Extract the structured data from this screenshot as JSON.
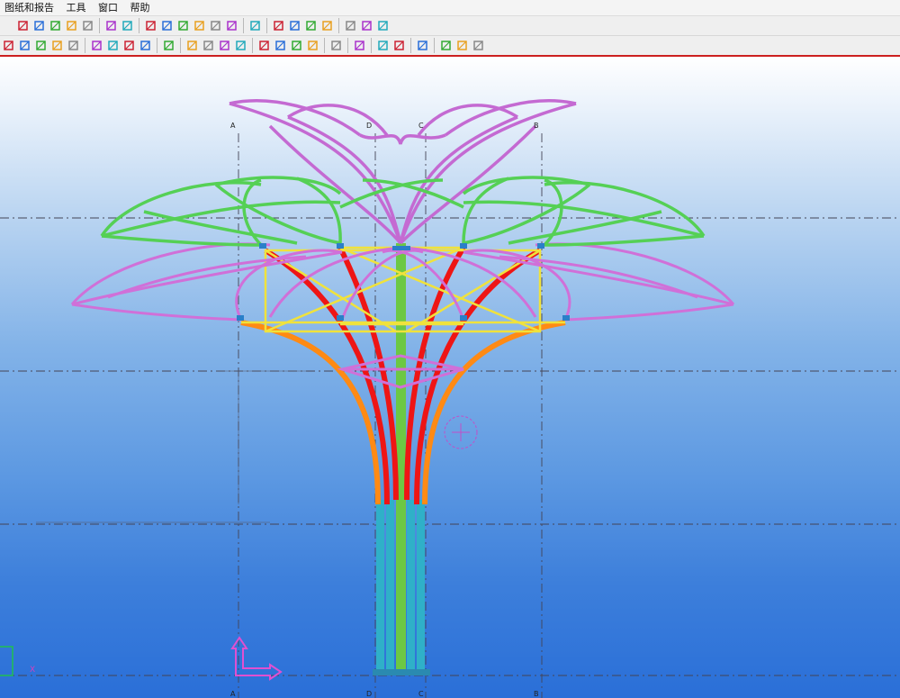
{
  "menu": {
    "items": [
      "图纸和报告",
      "工具",
      "窗口",
      "帮助"
    ]
  },
  "toolbar1": {
    "icons": [
      "beam-icon",
      "plate-icon",
      "bent-beam-icon",
      "curved-beam-icon",
      "polybeam-icon",
      "bolt-icon",
      "weld-icon",
      "line-icon",
      "point-icon",
      "point-icon",
      "point-icon",
      "point-icon",
      "point-icon",
      "circle-icon",
      "binoculars-icon",
      "component-icon",
      "detail-icon",
      "grid-icon",
      "grid-icon",
      "property-icon",
      "view-icon"
    ]
  },
  "toolbar2": {
    "icons": [
      "select-icon",
      "window-icon",
      "window-icon",
      "cut-icon",
      "cut-icon",
      "part-icon",
      "part-icon",
      "part-icon",
      "part-icon",
      "arrow-icon",
      "snap-icon",
      "snap-icon",
      "assembly-icon",
      "snap-icon",
      "snap-icon",
      "snap-icon",
      "snap-icon",
      "snap-icon",
      "pen-icon",
      "copy-icon",
      "report-icon",
      "drawing-icon",
      "save-icon",
      "expand-icon",
      "paint-icon",
      "shield-icon"
    ]
  },
  "viewport": {
    "grid_labels_top": [
      "A",
      "D",
      "C",
      "B"
    ],
    "grid_labels_bottom": [
      "A",
      "D",
      "C",
      "B"
    ],
    "axis_label": "X",
    "colors": {
      "green": "#55d055",
      "magenta": "#d070d8",
      "red": "#ee1515",
      "orange": "#ff8a14",
      "yellow": "#f0e23c",
      "cyan": "#2fb0c8",
      "trunk_green": "#6cc844"
    }
  }
}
